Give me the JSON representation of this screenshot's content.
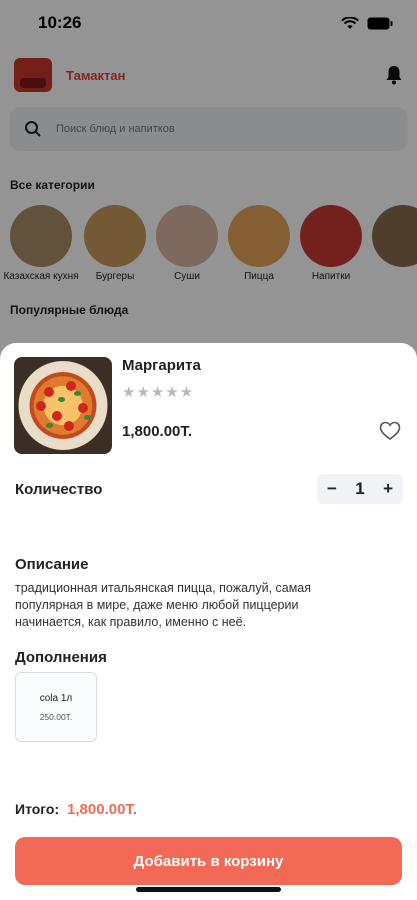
{
  "status": {
    "time": "10:26"
  },
  "header": {
    "brand": "Тамактан"
  },
  "search": {
    "placeholder": "Поиск блюд и напитков"
  },
  "categories": {
    "title": "Все категории",
    "items": [
      {
        "label": "Казахская кухня",
        "color": "#a98c66"
      },
      {
        "label": "Бургеры",
        "color": "#c89a5a"
      },
      {
        "label": "Суши",
        "color": "#d8b5a3"
      },
      {
        "label": "Пицца",
        "color": "#e6a35a"
      },
      {
        "label": "Напитки",
        "color": "#c93a35"
      },
      {
        "label": "",
        "color": "#8a6b4f"
      }
    ]
  },
  "popular": {
    "title": "Популярные блюда"
  },
  "product": {
    "name": "Маргарита",
    "stars": "★★★★★",
    "price": "1,800.00Т.",
    "quantity_label": "Количество",
    "quantity": "1",
    "minus": "−",
    "plus": "+",
    "description_title": "Описание",
    "description": "традиционная итальянская пицца, пожалуй, самая популярная в мире, даже меню любой пиццерии начинается, как правило, именно с неё.",
    "addons_title": "Дополнения",
    "addons": [
      {
        "name": "cola 1л",
        "price": "250.00Т."
      }
    ],
    "total_label": "Итого:",
    "total_value": "1,800.00Т.",
    "cta": "Добавить в корзину"
  },
  "colors": {
    "accent": "#f26a55",
    "brand": "#e0443a"
  }
}
